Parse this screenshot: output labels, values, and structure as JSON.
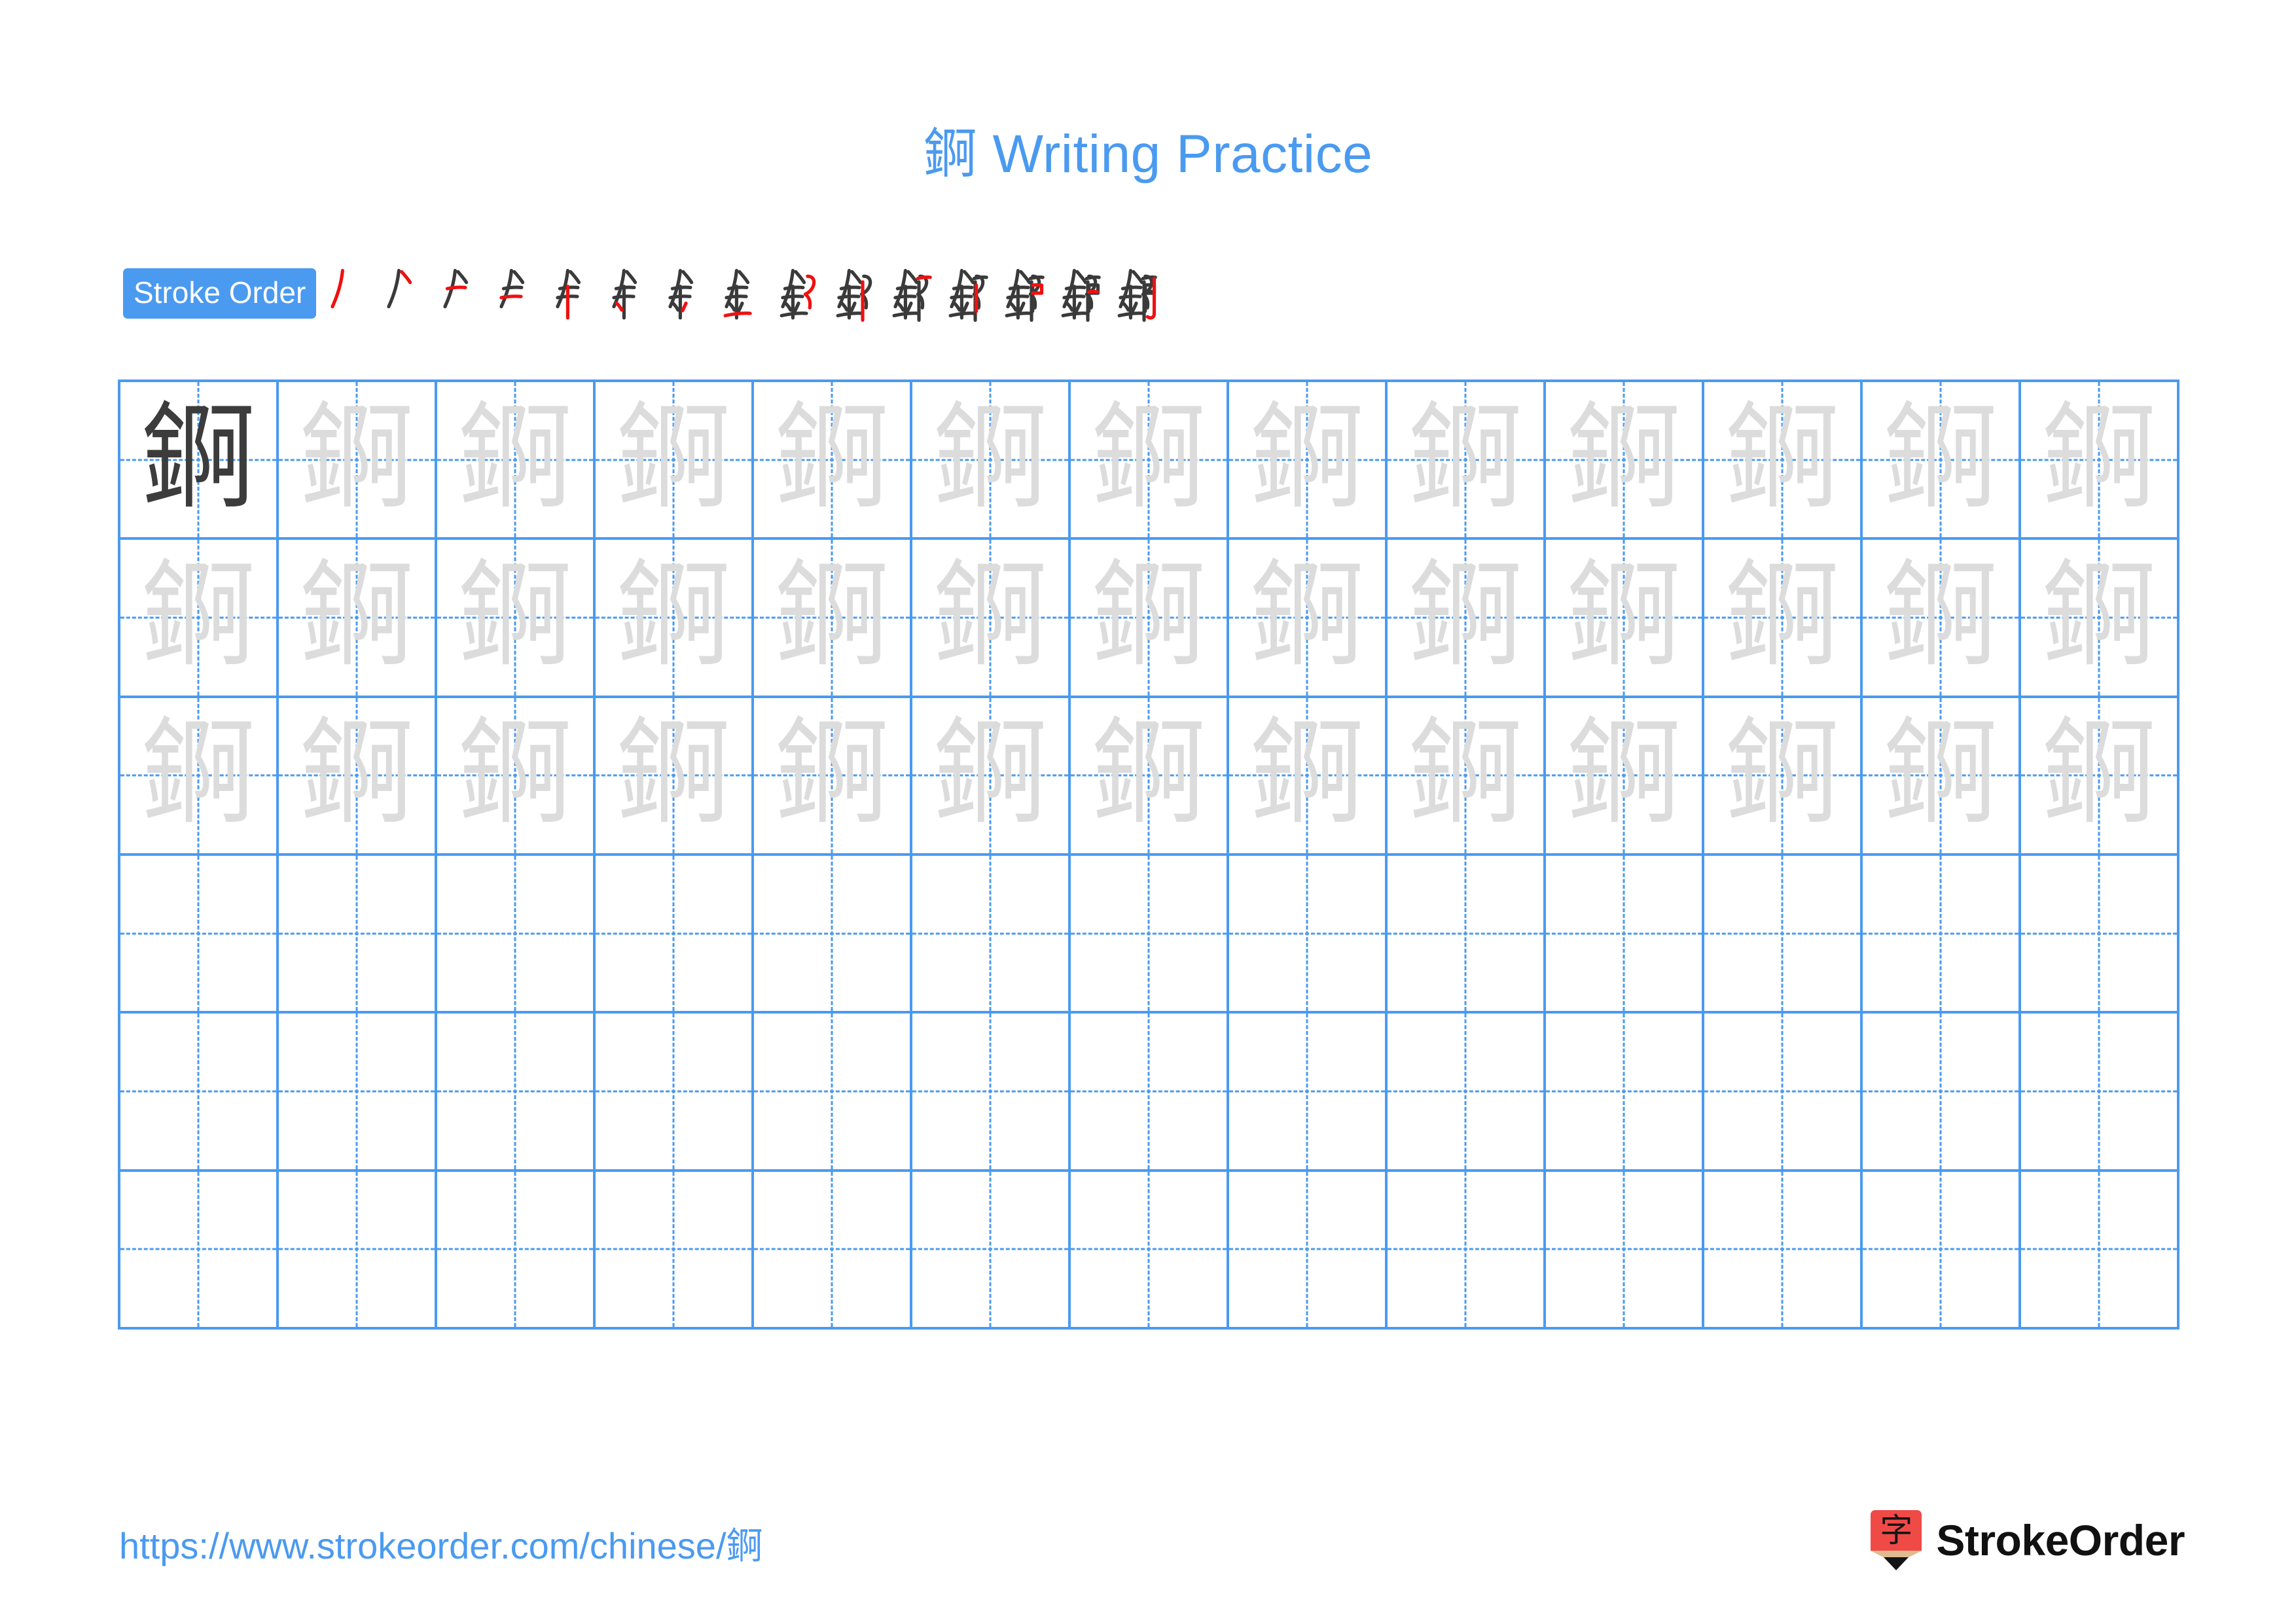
{
  "page": {
    "character": "錒",
    "title": "錒 Writing Practice",
    "title_character": "錒",
    "title_suffix": " Writing Practice",
    "accent_color": "#4a9af0",
    "stroke_new_color": "#ee1111",
    "stroke_done_color": "#3a3a3a",
    "trace_color": "#dcdcdc",
    "model_color": "#3c3c3c"
  },
  "stroke_order": {
    "label": "Stroke Order",
    "total_strokes": 15,
    "frames": [
      {
        "index": 1,
        "new_stroke": "丿",
        "cumulative": "丿"
      },
      {
        "index": 2,
        "new_stroke": "㇔",
        "cumulative": "𠂉"
      },
      {
        "index": 3,
        "new_stroke": "一",
        "cumulative": "𠂉一"
      },
      {
        "index": 4,
        "new_stroke": "一",
        "cumulative": "𠂉二"
      },
      {
        "index": 5,
        "new_stroke": "丨",
        "cumulative": "牟上"
      },
      {
        "index": 6,
        "new_stroke": "㇔",
        "cumulative": "金上"
      },
      {
        "index": 7,
        "new_stroke": "㇔",
        "cumulative": "金中"
      },
      {
        "index": 8,
        "new_stroke": "一",
        "cumulative": "金"
      },
      {
        "index": 9,
        "new_stroke": "㇆",
        "cumulative": "釒⺁"
      },
      {
        "index": 10,
        "new_stroke": "丨",
        "cumulative": "鄒"
      },
      {
        "index": 11,
        "new_stroke": "一",
        "cumulative": "鄒一"
      },
      {
        "index": 12,
        "new_stroke": "丨",
        "cumulative": "鈳左"
      },
      {
        "index": 13,
        "new_stroke": "㇕",
        "cumulative": "鈳中"
      },
      {
        "index": 14,
        "new_stroke": "一",
        "cumulative": "鈳右"
      },
      {
        "index": 15,
        "new_stroke": "亅",
        "cumulative": "錒"
      }
    ]
  },
  "grid": {
    "columns": 13,
    "rows": 6,
    "filled_rows": 3,
    "empty_rows": 3,
    "model_cell": {
      "row": 1,
      "column": 1
    },
    "trace_character": "錒",
    "model_character": "錒"
  },
  "footer": {
    "url_prefix": "https://www.strokeorder.com/chinese/",
    "url_character": "錒",
    "url_full": "https://www.strokeorder.com/chinese/錒",
    "brand_name": "StrokeOrder",
    "logo_glyph": "字",
    "logo_body_color": "#f04a47",
    "logo_wood_color": "#e0bb92",
    "logo_tip_color": "#141414"
  }
}
